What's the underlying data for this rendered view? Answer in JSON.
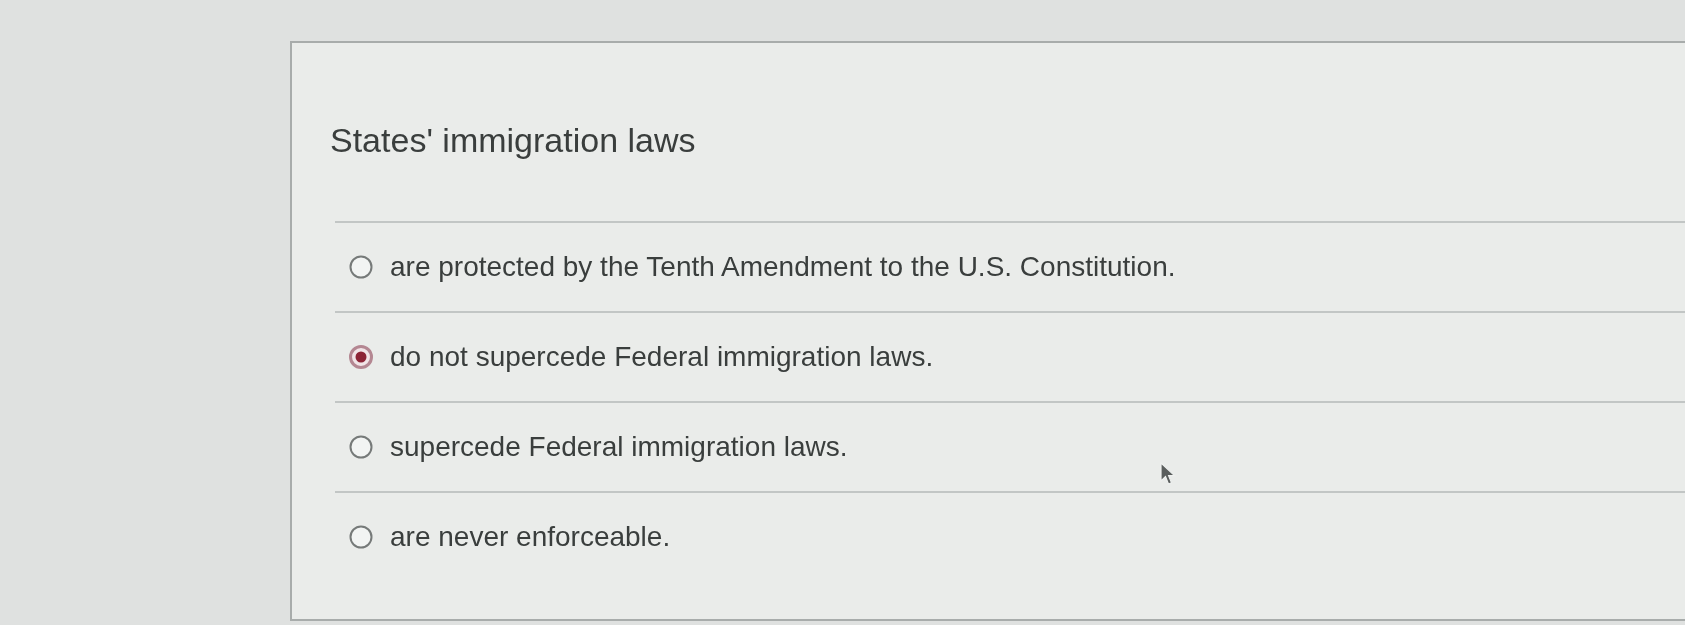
{
  "question": {
    "prompt": "States' immigration laws",
    "options": [
      {
        "label": "are protected by the Tenth Amendment to the U.S. Constitution.",
        "selected": false
      },
      {
        "label": "do not supercede Federal immigration laws.",
        "selected": true
      },
      {
        "label": "supercede Federal immigration laws.",
        "selected": false
      },
      {
        "label": "are never enforceable.",
        "selected": false
      }
    ]
  }
}
